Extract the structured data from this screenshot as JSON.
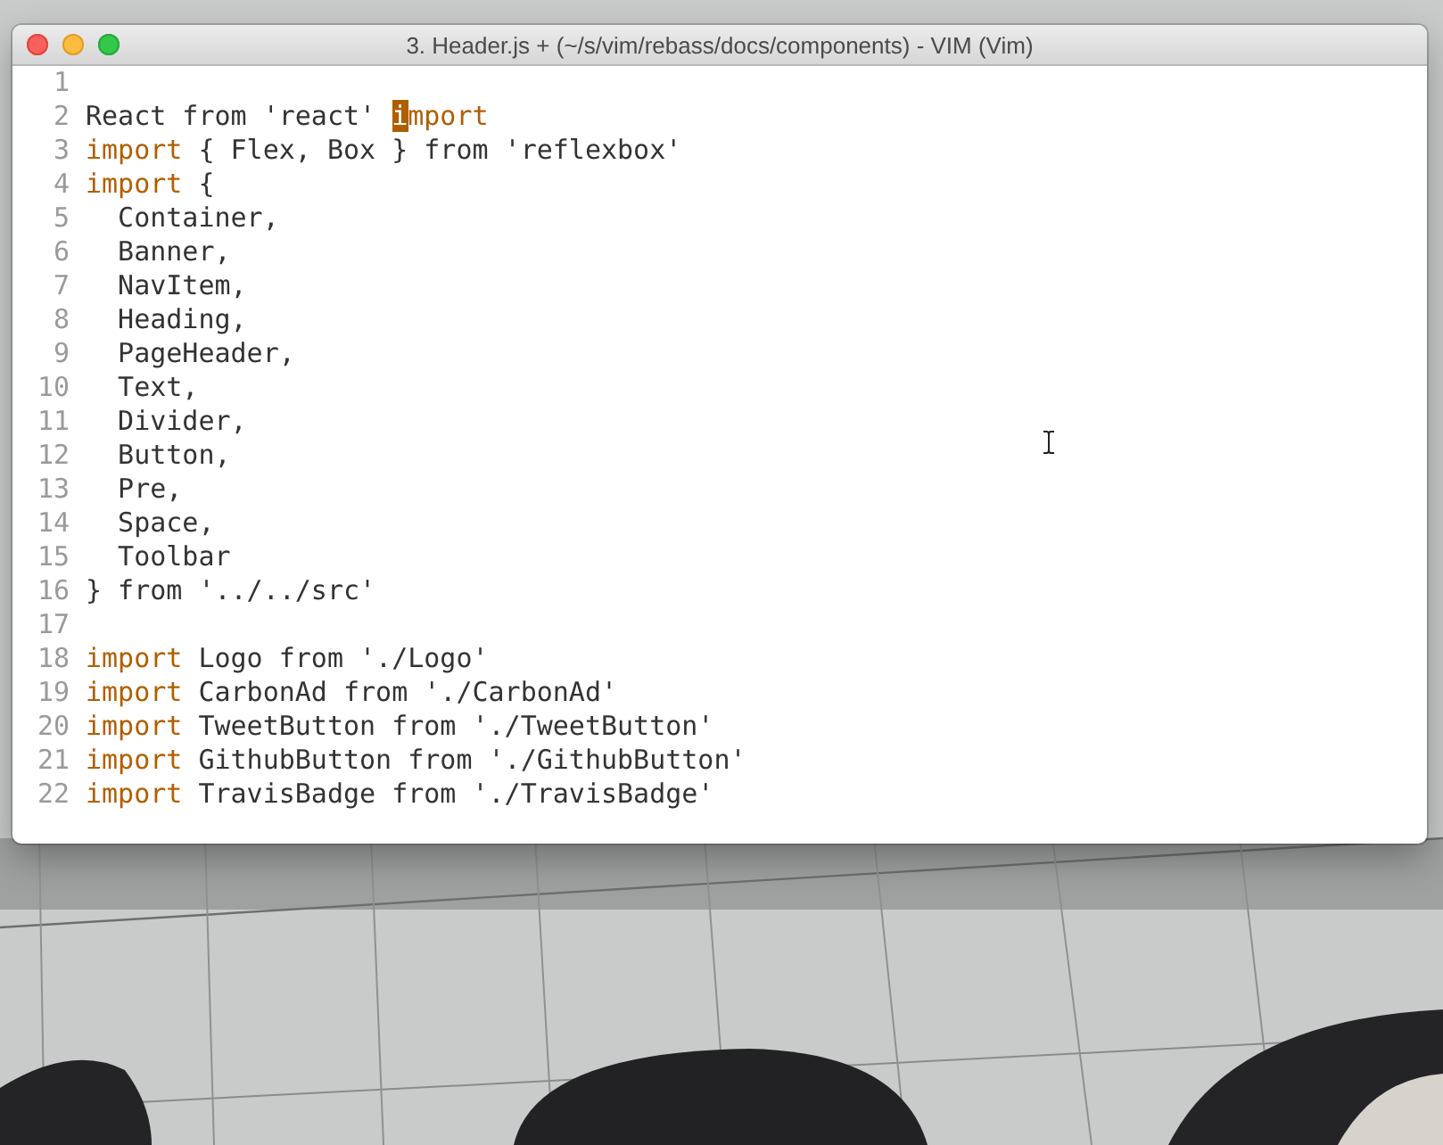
{
  "window": {
    "title": "3. Header.js + (~/s/vim/rebass/docs/components) - VIM (Vim)"
  },
  "editor": {
    "lines": [
      {
        "number": "1"
      },
      {
        "number": "2",
        "segments": [
          {
            "kind": "text",
            "text": "React from 'react' "
          },
          {
            "kind": "cursor",
            "text": "i"
          },
          {
            "kind": "keyword",
            "text": "mport"
          }
        ]
      },
      {
        "number": "3",
        "segments": [
          {
            "kind": "keyword",
            "text": "import"
          },
          {
            "kind": "text",
            "text": " { Flex, Box } from 'reflexbox'"
          }
        ]
      },
      {
        "number": "4",
        "segments": [
          {
            "kind": "keyword",
            "text": "import"
          },
          {
            "kind": "text",
            "text": " {"
          }
        ]
      },
      {
        "number": "5",
        "segments": [
          {
            "kind": "text",
            "text": "  Container,"
          }
        ]
      },
      {
        "number": "6",
        "segments": [
          {
            "kind": "text",
            "text": "  Banner,"
          }
        ]
      },
      {
        "number": "7",
        "segments": [
          {
            "kind": "text",
            "text": "  NavItem,"
          }
        ]
      },
      {
        "number": "8",
        "segments": [
          {
            "kind": "text",
            "text": "  Heading,"
          }
        ]
      },
      {
        "number": "9",
        "segments": [
          {
            "kind": "text",
            "text": "  PageHeader,"
          }
        ]
      },
      {
        "number": "10",
        "segments": [
          {
            "kind": "text",
            "text": "  Text,"
          }
        ]
      },
      {
        "number": "11",
        "segments": [
          {
            "kind": "text",
            "text": "  Divider,"
          }
        ]
      },
      {
        "number": "12",
        "segments": [
          {
            "kind": "text",
            "text": "  Button,"
          }
        ]
      },
      {
        "number": "13",
        "segments": [
          {
            "kind": "text",
            "text": "  Pre,"
          }
        ]
      },
      {
        "number": "14",
        "segments": [
          {
            "kind": "text",
            "text": "  Space,"
          }
        ]
      },
      {
        "number": "15",
        "segments": [
          {
            "kind": "text",
            "text": "  Toolbar"
          }
        ]
      },
      {
        "number": "16",
        "segments": [
          {
            "kind": "text",
            "text": "} from '../../src'"
          }
        ]
      },
      {
        "number": "17"
      },
      {
        "number": "18",
        "segments": [
          {
            "kind": "keyword",
            "text": "import"
          },
          {
            "kind": "text",
            "text": " Logo from './Logo'"
          }
        ]
      },
      {
        "number": "19",
        "segments": [
          {
            "kind": "keyword",
            "text": "import"
          },
          {
            "kind": "text",
            "text": " CarbonAd from './CarbonAd'"
          }
        ]
      },
      {
        "number": "20",
        "segments": [
          {
            "kind": "keyword",
            "text": "import"
          },
          {
            "kind": "text",
            "text": " TweetButton from './TweetButton'"
          }
        ]
      },
      {
        "number": "21",
        "segments": [
          {
            "kind": "keyword",
            "text": "import"
          },
          {
            "kind": "text",
            "text": " GithubButton from './GithubButton'"
          }
        ]
      },
      {
        "number": "22",
        "segments": [
          {
            "kind": "keyword",
            "text": "import"
          },
          {
            "kind": "text",
            "text": " TravisBadge from './TravisBadge'"
          }
        ]
      }
    ]
  }
}
